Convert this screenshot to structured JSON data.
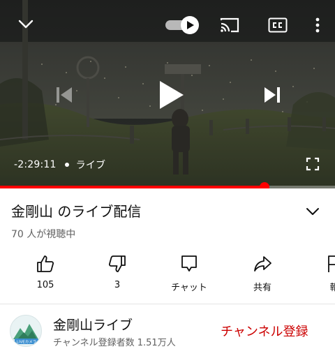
{
  "player": {
    "time_remaining": "-2:29:11",
    "live_label": "ライブ",
    "progress_fraction": 0.79,
    "icons": {
      "minimize": "chevron-down-icon",
      "autoplay": "autoplay-toggle-icon",
      "cast": "cast-icon",
      "captions": "closed-captions-icon",
      "more": "more-vert-icon",
      "previous": "skip-previous-icon",
      "play": "play-icon",
      "next": "skip-next-icon",
      "fullscreen": "fullscreen-icon"
    },
    "progress_color": "#ff0000"
  },
  "video": {
    "title": "金剛山 のライブ配信",
    "viewers": "70 人が視聴中"
  },
  "actions": [
    {
      "label": "105",
      "icon": "thumbs-up-icon"
    },
    {
      "label": "3",
      "icon": "thumbs-down-icon"
    },
    {
      "label": "チャット",
      "icon": "chat-icon"
    },
    {
      "label": "共有",
      "icon": "share-icon"
    },
    {
      "label": "報",
      "icon": "report-flag-icon"
    }
  ],
  "channel": {
    "name": "金剛山ライブ",
    "subscribers": "チャンネル登録者数 1.51万人",
    "subscribe_label": "チャンネル登録",
    "avatar_text": "LIVEカメラ",
    "subscribe_color": "#cc0000"
  }
}
